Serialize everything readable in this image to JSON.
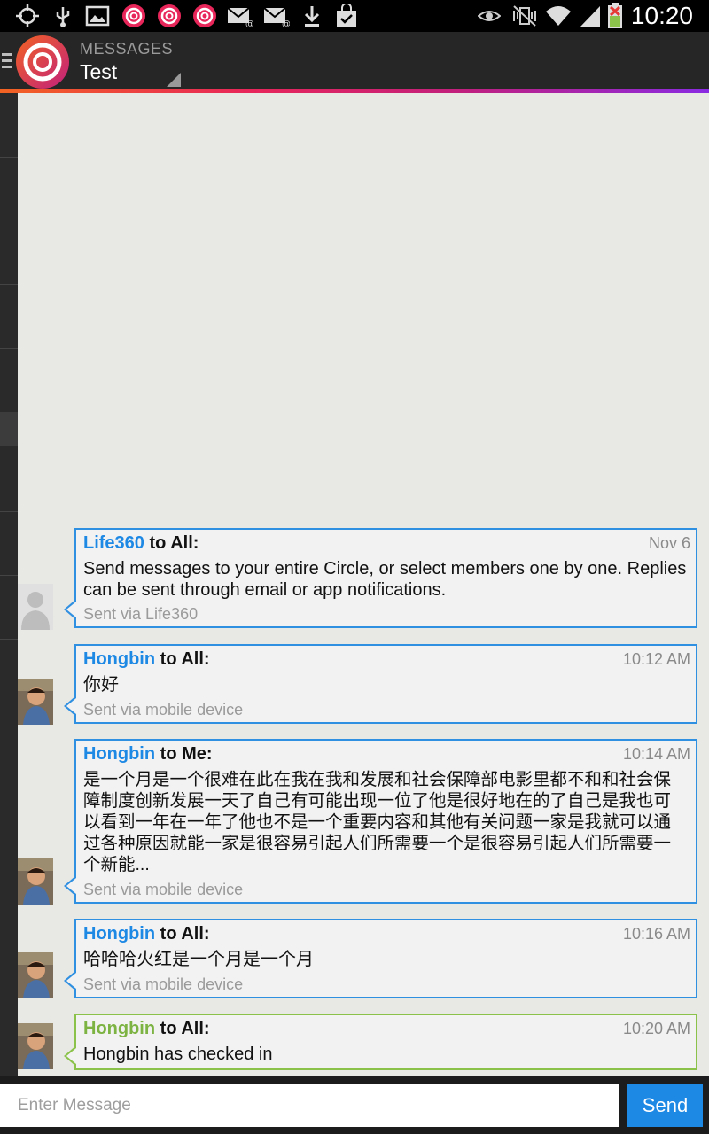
{
  "status_bar": {
    "time": "10:20",
    "icons": [
      "gps-icon",
      "usb-icon",
      "image-icon",
      "life360-notif-icon",
      "life360-notif-icon",
      "life360-notif-icon",
      "email-icon",
      "email-icon",
      "download-icon",
      "store-check-icon",
      "eye-icon",
      "mute-vibrate-icon",
      "wifi-icon",
      "signal-icon",
      "battery-icon"
    ]
  },
  "action_bar": {
    "section": "MESSAGES",
    "circle_name": "Test"
  },
  "messages": [
    {
      "sender": "Life360",
      "recipient": "to All:",
      "time": "Nov 6",
      "body": "Send messages to your entire Circle, or select members one by one. Replies can be sent through email or app notifications.",
      "via": "Sent via Life360",
      "color": "#1e88e5"
    },
    {
      "sender": "Hongbin",
      "recipient": "to All:",
      "time": "10:12 AM",
      "body": "你好",
      "via": "Sent via mobile device",
      "color": "#1e88e5"
    },
    {
      "sender": "Hongbin",
      "recipient": "to Me:",
      "time": "10:14 AM",
      "body": "是一个月是一个很难在此在我在我和发展和社会保障部电影里都不和和社会保障制度创新发展一天了自己有可能出现一位了他是很好地在的了自己是我也可以看到一年在一年了他也不是一个重要内容和其他有关问题一家是我就可以通过各种原因就能一家是很容易引起人们所需要一个是很容易引起人们所需要一个新能...",
      "via": "Sent via mobile device",
      "color": "#1e88e5"
    },
    {
      "sender": "Hongbin",
      "recipient": "to All:",
      "time": "10:16 AM",
      "body": "哈哈哈火红是一个月是一个月",
      "via": "Sent via mobile device",
      "color": "#1e88e5"
    },
    {
      "sender": "Hongbin",
      "recipient": "to All:",
      "time": "10:20 AM",
      "body": "Hongbin has checked in",
      "via": "",
      "color": "#7cb342"
    }
  ],
  "composer": {
    "placeholder": "Enter Message",
    "send_label": "Send"
  }
}
